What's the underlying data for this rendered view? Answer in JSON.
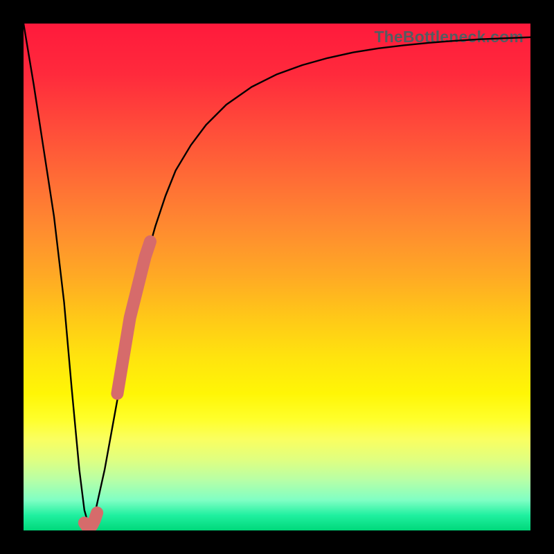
{
  "watermark": "TheBottleneck.com",
  "chart_data": {
    "type": "line",
    "title": "",
    "xlabel": "",
    "ylabel": "",
    "xlim": [
      0,
      100
    ],
    "ylim": [
      0,
      100
    ],
    "series": [
      {
        "name": "curve",
        "x": [
          0,
          2,
          4,
          6,
          8,
          9.5,
          11,
          12,
          13,
          14,
          16,
          18,
          20,
          22,
          24,
          26,
          28,
          30,
          33,
          36,
          40,
          45,
          50,
          55,
          60,
          65,
          70,
          75,
          80,
          85,
          90,
          95,
          100
        ],
        "y": [
          100,
          88,
          75,
          62,
          45,
          28,
          12,
          4,
          0.5,
          3,
          12,
          23,
          34,
          44,
          53,
          60,
          66,
          71,
          76,
          80,
          84,
          87.5,
          90,
          91.8,
          93.2,
          94.3,
          95.1,
          95.7,
          96.2,
          96.6,
          96.9,
          97.1,
          97.3
        ]
      },
      {
        "name": "salmon-dots",
        "x": [
          12.0,
          12.5,
          13.0,
          13.5,
          14.0,
          14.5,
          18.5,
          19.0,
          19.5,
          20.0,
          20.5,
          21.0,
          21.5,
          22.0,
          22.5,
          23.0,
          23.5,
          24.0,
          24.5,
          25.0
        ],
        "y": [
          1.5,
          0.8,
          0.5,
          1.0,
          2.0,
          3.5,
          27,
          30,
          33,
          36,
          39,
          42,
          44,
          46,
          48,
          50,
          52,
          54,
          55.5,
          57
        ]
      }
    ],
    "colors": {
      "curve": "#000000",
      "dots": "#d66b6b"
    }
  }
}
